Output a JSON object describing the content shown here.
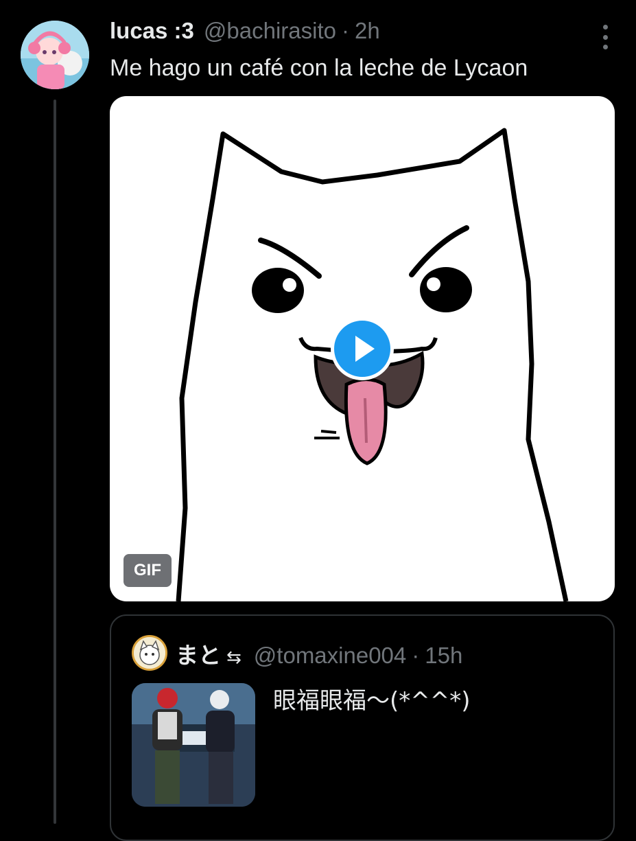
{
  "tweet": {
    "display_name": "lucas :3",
    "handle": "@bachirasito",
    "separator": "·",
    "time": "2h",
    "text": "Me hago un café con la leche de Lycaon",
    "avatar_icon": "user-avatar",
    "more_icon": "more-vertical-icon",
    "media": {
      "badge": "GIF",
      "play_icon": "play-icon",
      "accent_color": "#1d9bf0"
    }
  },
  "quoted_tweet": {
    "display_name": "まと",
    "name_symbol": "⇆",
    "handle": "@tomaxine004",
    "separator": "·",
    "time": "15h",
    "text": "眼福眼福〜(*^^*)"
  },
  "colors": {
    "background": "#000000",
    "primary_text": "#e7e9ea",
    "secondary_text": "#71767b",
    "border": "#2f3336",
    "accent": "#1d9bf0"
  }
}
